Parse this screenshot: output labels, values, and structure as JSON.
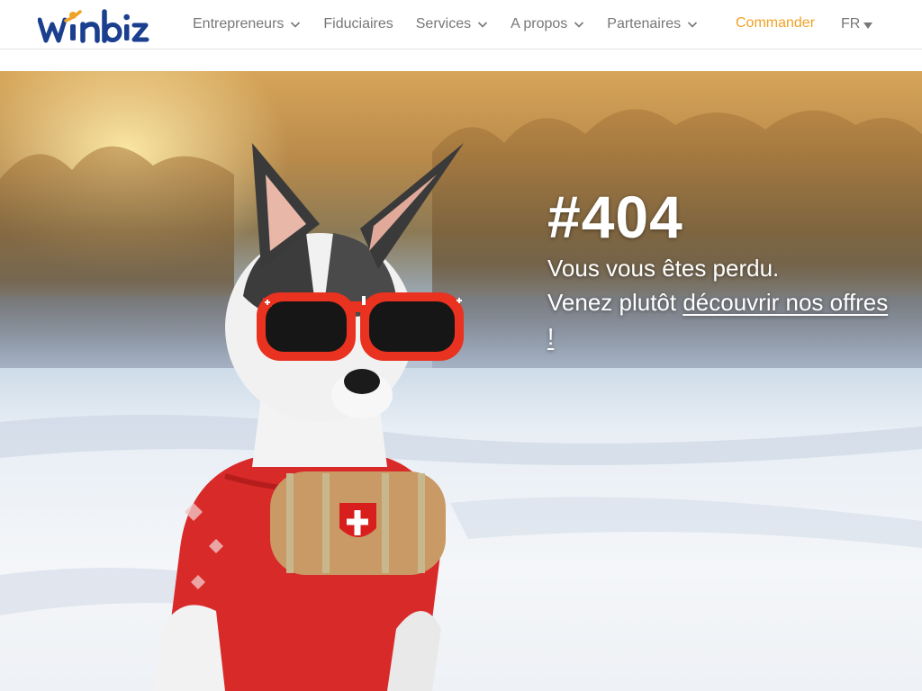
{
  "header": {
    "logo_text": "winbiz",
    "nav": [
      {
        "label": "Entrepreneurs",
        "has_dropdown": true
      },
      {
        "label": "Fiduciaires",
        "has_dropdown": false
      },
      {
        "label": "Services",
        "has_dropdown": true
      },
      {
        "label": "A propos",
        "has_dropdown": true
      },
      {
        "label": "Partenaires",
        "has_dropdown": true
      }
    ],
    "order_label": "Commander",
    "language": "FR"
  },
  "hero": {
    "error_code": "#404",
    "line1": "Vous vous êtes perdu.",
    "line2_prefix": "Venez plutôt ",
    "line2_link": "découvrir nos offres !"
  },
  "colors": {
    "brand_blue": "#1b3f8f",
    "brand_orange": "#f0a226",
    "nav_text": "#777777"
  }
}
